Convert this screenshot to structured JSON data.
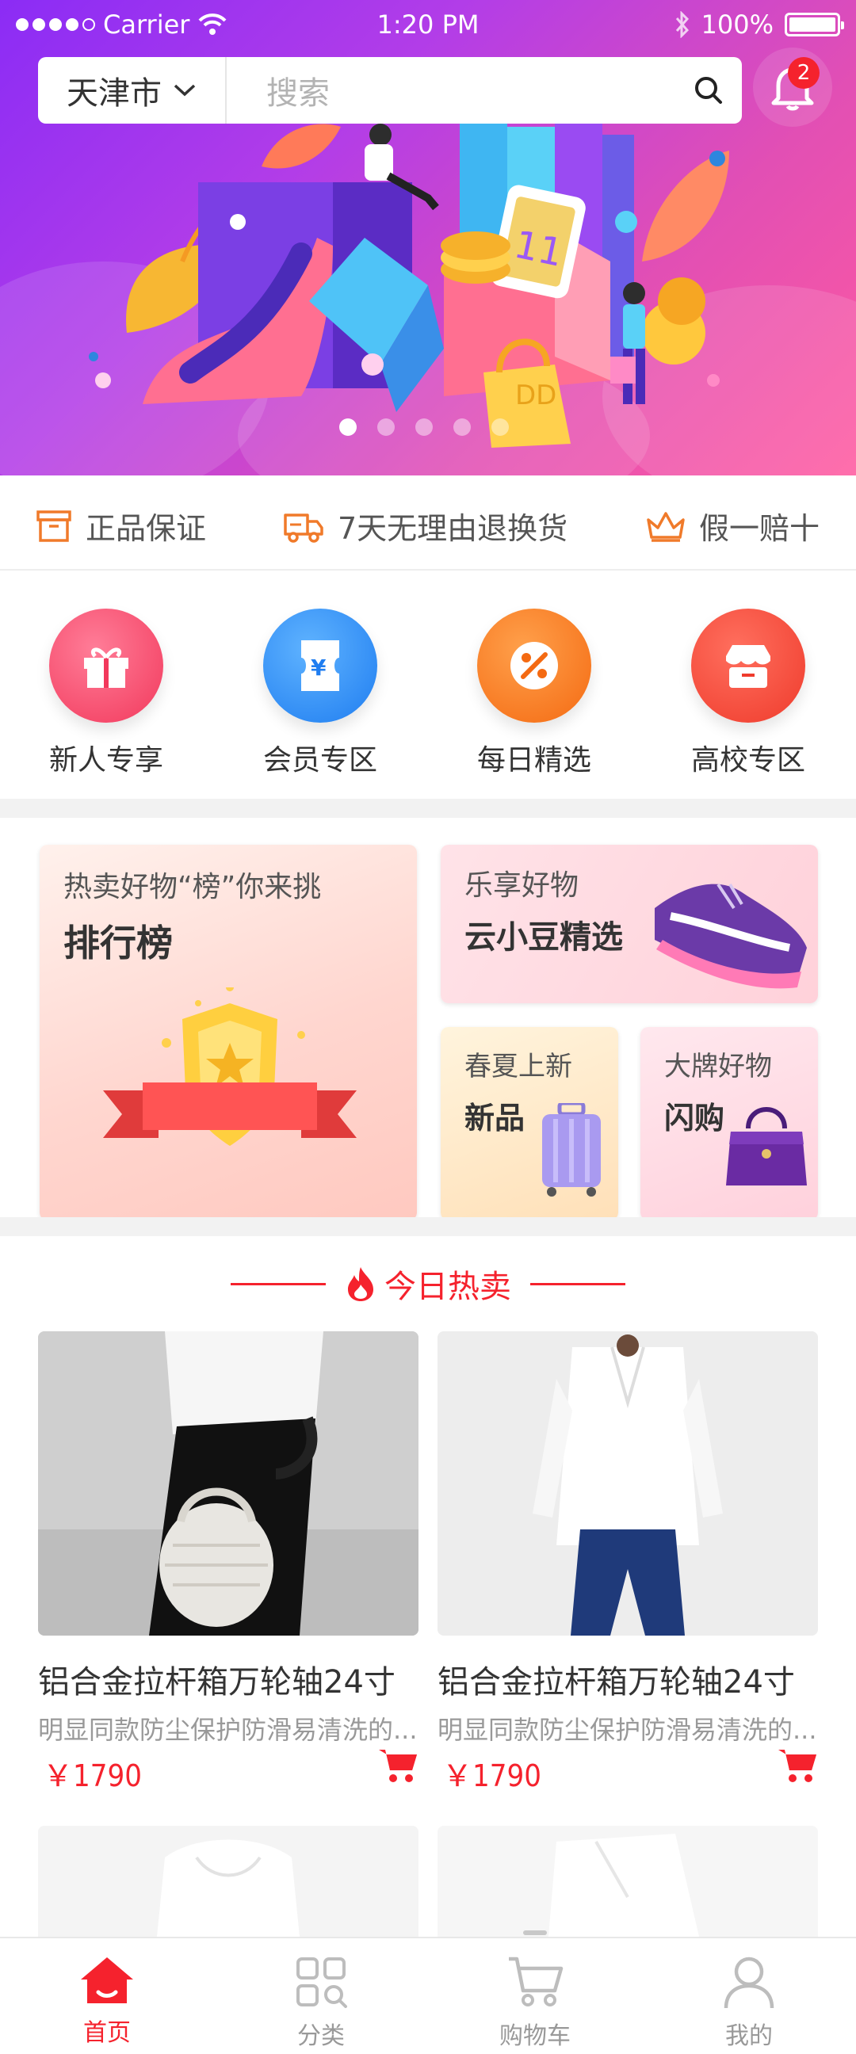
{
  "status_bar": {
    "carrier": "Carrier",
    "time": "1:20 PM",
    "battery": "100%"
  },
  "header": {
    "city": "天津市",
    "search_placeholder": "搜索",
    "notification_count": "2"
  },
  "banner": {
    "page_count": 5,
    "active_index": 0
  },
  "guarantees": [
    {
      "label": "正品保证",
      "icon": "box-icon"
    },
    {
      "label": "7天无理由退换货",
      "icon": "truck-icon"
    },
    {
      "label": "假一赔十",
      "icon": "crown-icon"
    }
  ],
  "categories": [
    {
      "label": "新人专享",
      "icon": "gift-icon",
      "color": "#f54a6d"
    },
    {
      "label": "会员专区",
      "icon": "ticket-icon",
      "color": "#2f8cf5"
    },
    {
      "label": "每日精选",
      "icon": "discount-icon",
      "color": "#fb7a1e"
    },
    {
      "label": "高校专区",
      "icon": "store-icon",
      "color": "#f5423a"
    }
  ],
  "promos": {
    "ranking": {
      "subtitle": "热卖好物“榜”你来挑",
      "title": "排行榜"
    },
    "yunxiaodou": {
      "subtitle": "乐享好物",
      "title": "云小豆精选"
    },
    "new_arrivals": {
      "subtitle": "春夏上新",
      "title": "新品"
    },
    "flash_sale": {
      "subtitle": "大牌好物",
      "title": "闪购"
    }
  },
  "hot": {
    "title": "今日热卖",
    "products": [
      {
        "name": "铝合金拉杆箱万轮轴24寸",
        "desc": "明显同款防尘保护防滑易清洗的...",
        "price": "￥1790"
      },
      {
        "name": "铝合金拉杆箱万轮轴24寸",
        "desc": "明显同款防尘保护防滑易清洗的...",
        "price": "￥1790"
      }
    ]
  },
  "tabbar": [
    {
      "label": "首页",
      "active": true
    },
    {
      "label": "分类",
      "active": false
    },
    {
      "label": "购物车",
      "active": false
    },
    {
      "label": "我的",
      "active": false
    }
  ],
  "colors": {
    "accent": "#f5222d",
    "hero_start": "#8b2cf5",
    "hero_end": "#ff5aa0"
  }
}
